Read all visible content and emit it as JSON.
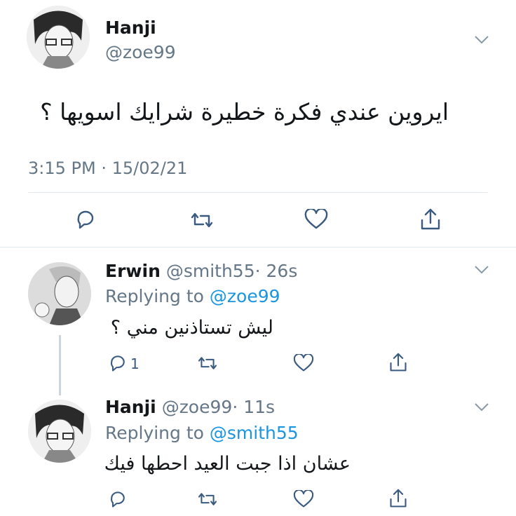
{
  "main_tweet": {
    "author_name": "Hanji",
    "author_handle": "@zoe99",
    "text": "ايروين عندي فكرة خطيرة شرايك اسويها ؟",
    "timestamp": "3:15 PM · 15/02/21"
  },
  "replies": [
    {
      "author_name": "Erwin",
      "author_handle": "@smith55",
      "time": "· 26s",
      "replying_prefix": "Replying to",
      "replying_to": "@zoe99",
      "text": "ليش تستاذنين مني ؟",
      "reply_count": "1"
    },
    {
      "author_name": "Hanji",
      "author_handle": "@zoe99",
      "time": "· 11s",
      "replying_prefix": "Replying to",
      "replying_to": "@smith55",
      "text": "عشان اذا جبت العيد احطها فيك"
    }
  ],
  "icons": {
    "reply": "reply-icon",
    "retweet": "retweet-icon",
    "like": "heart-icon",
    "share": "share-icon",
    "menu": "chevron-down-icon"
  },
  "colors": {
    "text": "#14171a",
    "secondary": "#657786",
    "link": "#1b95e0",
    "divider": "#e1e8ed",
    "icon": "#3a5a80"
  }
}
